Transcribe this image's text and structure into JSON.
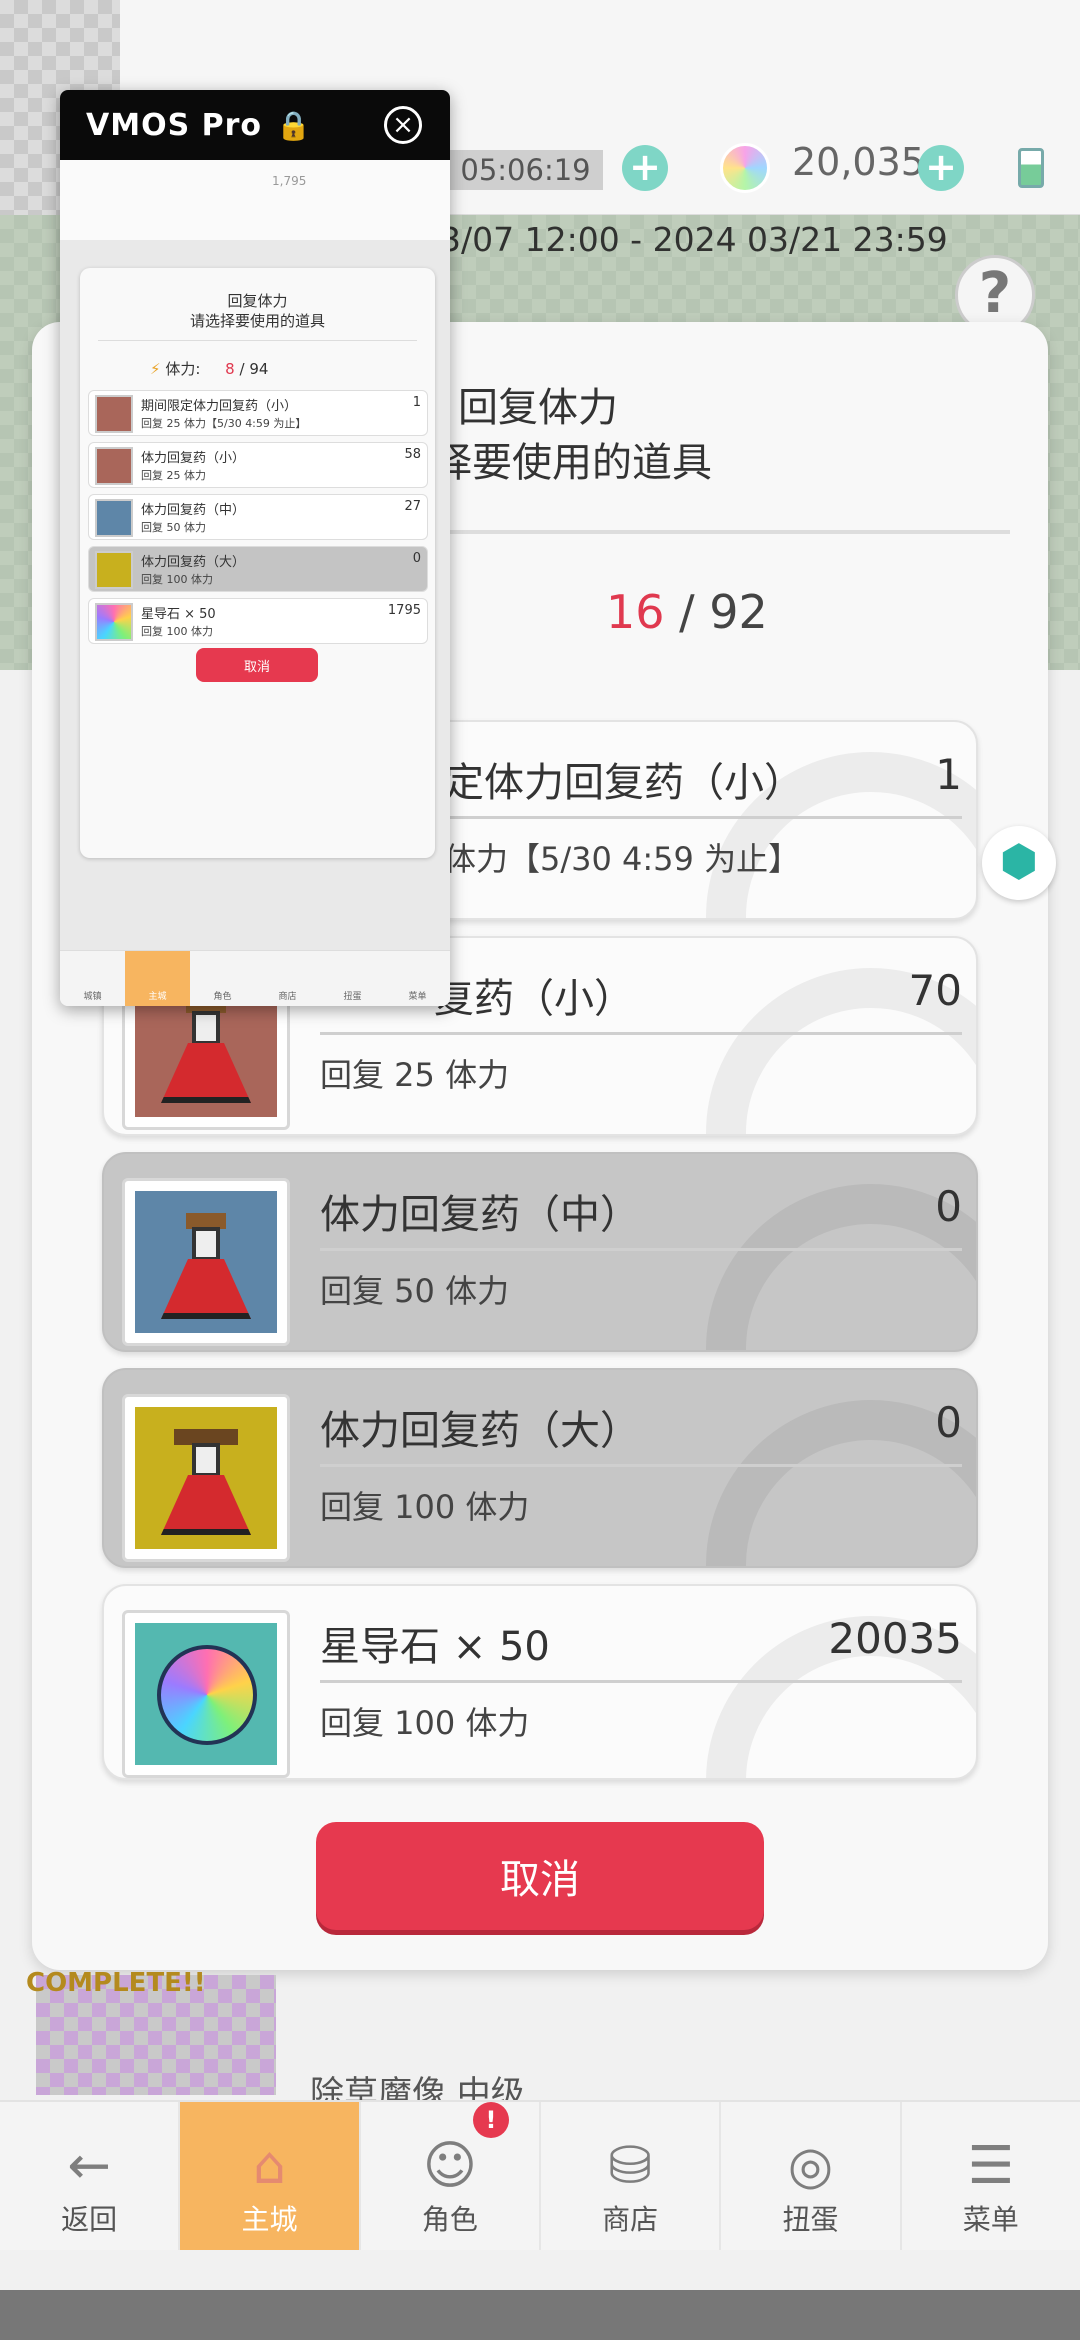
{
  "topbar": {
    "timer": "05:06:19",
    "gems": "20,035",
    "event_date": "3/07 12:00 - 2024 03/21 23:59"
  },
  "dialog": {
    "title": "回复体力",
    "subtitle": "择要使用的道具",
    "stamina_label": ":",
    "stamina_current": "16",
    "stamina_max": "/ 92",
    "items": [
      {
        "name": "定体力回复药（小）",
        "count": "1",
        "desc": "体力【5/30 4:59 为止】",
        "disabled": false,
        "icon": "potion-small-icon"
      },
      {
        "name": "复药（小）",
        "count": "70",
        "desc": "回复 25 体力",
        "disabled": false,
        "icon": "potion-small-icon"
      },
      {
        "name": "体力回复药（中）",
        "count": "0",
        "desc": "回复 50 体力",
        "disabled": true,
        "icon": "potion-medium-icon"
      },
      {
        "name": "体力回复药（大）",
        "count": "0",
        "desc": "回复 100 体力",
        "disabled": true,
        "icon": "potion-large-icon"
      },
      {
        "name": "星导石 × 50",
        "count": "20035",
        "desc": "回复 100 体力",
        "disabled": false,
        "icon": "star-stone-icon"
      }
    ],
    "cancel_label": "取消"
  },
  "background": {
    "quest_text": "除草魔像 中级",
    "complete_text": "COMPLETE!!"
  },
  "nav": [
    {
      "label": "返回",
      "icon": "back-arrow-icon",
      "glyph": "←"
    },
    {
      "label": "主城",
      "icon": "castle-icon",
      "glyph": "⌂",
      "active": true
    },
    {
      "label": "角色",
      "icon": "character-icon",
      "glyph": "☺",
      "badge": "!"
    },
    {
      "label": "商店",
      "icon": "shop-icon",
      "glyph": "⛁"
    },
    {
      "label": "扭蛋",
      "icon": "gacha-icon",
      "glyph": "◎"
    },
    {
      "label": "菜单",
      "icon": "menu-icon",
      "glyph": "☰"
    }
  ],
  "vmos": {
    "title": "VMOS Pro",
    "lock_glyph": "🔒",
    "close_glyph": "×",
    "top_gems": "1,795",
    "dialog_title": "回复体力",
    "dialog_subtitle": "请选择要使用的道具",
    "stamina_label": "体力:",
    "stamina_current": "8",
    "stamina_max": "/ 94",
    "items": [
      {
        "name": "期间限定体力回复药（小）",
        "count": "1",
        "desc": "回复 25 体力【5/30 4:59 为止】",
        "disabled": false
      },
      {
        "name": "体力回复药（小）",
        "count": "58",
        "desc": "回复 25 体力",
        "disabled": false
      },
      {
        "name": "体力回复药（中）",
        "count": "27",
        "desc": "回复 50 体力",
        "disabled": false
      },
      {
        "name": "体力回复药（大）",
        "count": "0",
        "desc": "回复 100 体力",
        "disabled": true
      },
      {
        "name": "星导石 × 50",
        "count": "1795",
        "desc": "回复 100 体力",
        "disabled": false
      }
    ],
    "cancel_label": "取消",
    "nav": [
      "城镇",
      "主城",
      "角色",
      "商店",
      "扭蛋",
      "菜单"
    ],
    "nav_active": "主城"
  }
}
